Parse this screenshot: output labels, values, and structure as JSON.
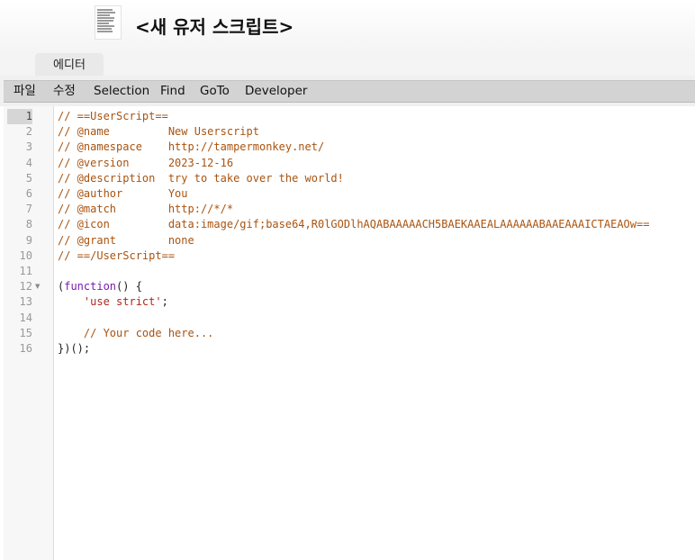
{
  "header": {
    "title": "<새 유저 스크립트>",
    "logo_icon": "script-document-icon"
  },
  "tabs": [
    {
      "label": "에디터"
    }
  ],
  "menu": {
    "items": [
      "파일",
      "수정",
      "Selection",
      "Find",
      "GoTo",
      "Developer"
    ]
  },
  "editor": {
    "active_line": 1,
    "fold_marker_line": 12,
    "line_numbers": [
      "1",
      "2",
      "3",
      "4",
      "5",
      "6",
      "7",
      "8",
      "9",
      "10",
      "11",
      "12",
      "13",
      "14",
      "15",
      "16"
    ],
    "lines": [
      {
        "parts": [
          {
            "t": "// ==UserScript==",
            "c": "cm"
          }
        ]
      },
      {
        "parts": [
          {
            "t": "// @name         New Userscript",
            "c": "cm"
          }
        ]
      },
      {
        "parts": [
          {
            "t": "// @namespace    http://tampermonkey.net/",
            "c": "cm"
          }
        ]
      },
      {
        "parts": [
          {
            "t": "// @version      2023-12-16",
            "c": "cm"
          }
        ]
      },
      {
        "parts": [
          {
            "t": "// @description  try to take over the world!",
            "c": "cm"
          }
        ]
      },
      {
        "parts": [
          {
            "t": "// @author       You",
            "c": "cm"
          }
        ]
      },
      {
        "parts": [
          {
            "t": "// @match        http://*/*",
            "c": "cm"
          }
        ]
      },
      {
        "parts": [
          {
            "t": "// @icon         data:image/gif;base64,R0lGODlhAQABAAAAACH5BAEKAAEALAAAAAABAAEAAAICTAEAOw==",
            "c": "cm"
          }
        ]
      },
      {
        "parts": [
          {
            "t": "// @grant        none",
            "c": "cm"
          }
        ]
      },
      {
        "parts": [
          {
            "t": "// ==/UserScript==",
            "c": "cm"
          }
        ]
      },
      {
        "parts": [
          {
            "t": "",
            "c": "pl"
          }
        ]
      },
      {
        "parts": [
          {
            "t": "(",
            "c": "pl"
          },
          {
            "t": "function",
            "c": "kw"
          },
          {
            "t": "() {",
            "c": "pl"
          }
        ]
      },
      {
        "parts": [
          {
            "t": "    ",
            "c": "pl"
          },
          {
            "t": "'use strict'",
            "c": "str"
          },
          {
            "t": ";",
            "c": "pl"
          }
        ]
      },
      {
        "parts": [
          {
            "t": "",
            "c": "pl"
          }
        ]
      },
      {
        "parts": [
          {
            "t": "    // Your code here...",
            "c": "cm"
          }
        ]
      },
      {
        "parts": [
          {
            "t": "})();",
            "c": "pl"
          }
        ]
      }
    ]
  },
  "colors": {
    "comment": "#a9530f",
    "keyword": "#7a1cab",
    "string": "#b0261f",
    "menubar": "#d3d3d3"
  }
}
